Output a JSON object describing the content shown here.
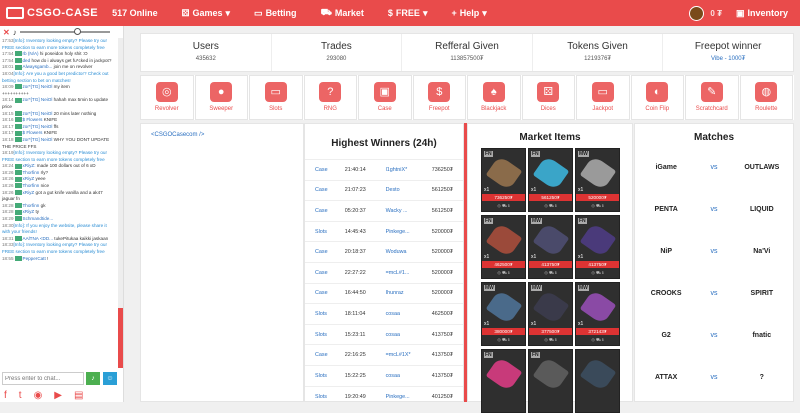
{
  "nav": {
    "logo": "CSGO-CASE",
    "online": "517 Online",
    "games": "Games",
    "betting": "Betting",
    "market": "Market",
    "free": "FREE",
    "help": "Help",
    "coins": "0 ₮",
    "inventory": "Inventory"
  },
  "colors": {
    "accent": "#e94b4b",
    "link": "#2a6fc0"
  },
  "chat": {
    "placeholder": "Press enter to chat...",
    "messages": [
      {
        "t": "17:53",
        "u": "[Info]:",
        "m": "Inventory looking empty? Please try our FREE section to earn more tokens completely free",
        "type": "info"
      },
      {
        "t": "17:54",
        "u": "rb (N/A)",
        "m": "hi poseidon holy shit :O",
        "type": "user"
      },
      {
        "t": "17:54",
        "u": "ded",
        "m": "how do i always get fu*cked in jackpot?",
        "type": "user"
      },
      {
        "t": "18:01",
        "u": "Alwaysgamb...",
        "m": "join me on revolver",
        "type": "user"
      },
      {
        "t": "18:04",
        "u": "[Info]:",
        "m": "Are you a good bet predictor? Check out betting section to bet on matches!",
        "type": "info"
      },
      {
        "t": "18:09",
        "u": "zor*[TG] NeiOl",
        "m": "my item",
        "type": "user"
      },
      {
        "t": "",
        "u": "",
        "m": "++++++++++",
        "type": "plain"
      },
      {
        "t": "18:14",
        "u": "zor*[TG] NeiOl",
        "m": "hahah max 5min to update price",
        "type": "user"
      },
      {
        "t": "18:15",
        "u": "zor*[TG] NeiOl",
        "m": "20 mins later nothing",
        "type": "user"
      },
      {
        "t": "18:16",
        "u": "$ Flowers",
        "m": "KNIFE",
        "type": "user"
      },
      {
        "t": "18:17",
        "u": "zor*[TG] NeiOl",
        "m": "ffs",
        "type": "user"
      },
      {
        "t": "18:17",
        "u": "$ Flowers",
        "m": "KNIFE",
        "type": "user"
      },
      {
        "t": "18:18",
        "u": "zor*[TG] NeiOl",
        "m": "WHY YOU DONT UPDATE THE PRICE FFS",
        "type": "user"
      },
      {
        "t": "18:19",
        "u": "[Info]:",
        "m": "Inventory looking empty? Please try our FREE section to earn more tokens completely free",
        "type": "info"
      },
      {
        "t": "18:24",
        "u": "xRiyZ:",
        "m": "made 100 dollars out of 6 xD",
        "type": "user"
      },
      {
        "t": "18:26",
        "u": "Thorfinn",
        "m": "rly?",
        "type": "user"
      },
      {
        "t": "18:26",
        "u": "xRiyZ",
        "m": "yeee",
        "type": "user"
      },
      {
        "t": "18:26",
        "u": "Thorfinn",
        "m": "nice",
        "type": "user"
      },
      {
        "t": "18:26",
        "u": "xRiyZ",
        "m": "got a gut knife vanilla and a ak47 jaguar fn",
        "type": "user"
      },
      {
        "t": "18:28",
        "u": "Thorfinn",
        "m": "gk",
        "type": "user"
      },
      {
        "t": "18:28",
        "u": "xRiyZ",
        "m": "ty",
        "type": "user"
      },
      {
        "t": "18:29",
        "u": "Schmandtide...",
        "m": "",
        "type": "user"
      },
      {
        "t": "18:30",
        "u": "[Info]:",
        "m": "If you enjoy the website, please share it with your friends!",
        "type": "info"
      },
      {
        "t": "18:31",
        "u": "AAlTNA <DD...",
        "m": "tukePitukaa kaikki jaskaan",
        "type": "user"
      },
      {
        "t": "18:33",
        "u": "[Info]:",
        "m": "Inventory looking empty? Please try our FREE section to earn more tokens completely free",
        "type": "info"
      },
      {
        "t": "18:55",
        "u": "PepperCatt",
        "m": "!",
        "type": "user"
      }
    ]
  },
  "stats": [
    {
      "label": "Users",
      "value": "435632",
      "link": false
    },
    {
      "label": "Trades",
      "value": "293080",
      "link": false
    },
    {
      "label": "Refferal Given",
      "value": "113857500₮",
      "link": false
    },
    {
      "label": "Tokens Given",
      "value": "1219376₮",
      "link": false
    },
    {
      "label": "Freepot winner",
      "value": "Vibe - 1000₮",
      "link": true
    }
  ],
  "games": [
    "Revolver",
    "Sweeper",
    "Slots",
    "RNG",
    "Case",
    "Freepot",
    "Blackjack",
    "Dices",
    "Jackpot",
    "Coin Flip",
    "Scratchcard",
    "Roulette"
  ],
  "panel1": {
    "link": "<CSGOCasecom />"
  },
  "winners": {
    "title": "Highest Winners (24h)",
    "rows": [
      [
        "Case",
        "21:40:14",
        "l1ghtniX*",
        "736250₮"
      ],
      [
        "Case",
        "21:07:23",
        "Desto",
        "561250₮"
      ],
      [
        "Case",
        "05:20:37",
        "Wacky ...",
        "561250₮"
      ],
      [
        "Slots",
        "14:45:43",
        "Pinkege...",
        "520000₮"
      ],
      [
        "Case",
        "20:18:37",
        "Woduwa",
        "520000₮"
      ],
      [
        "Case",
        "22:27:22",
        "=mcL#1...",
        "520000₮"
      ],
      [
        "Case",
        "16:44:50",
        "Ihunraz",
        "520000₮"
      ],
      [
        "Slots",
        "18:11:04",
        "cosaa",
        "462500₮"
      ],
      [
        "Slots",
        "15:23:11",
        "cosaa",
        "413750₮"
      ],
      [
        "Case",
        "22:16:25",
        "=mcL#1X*",
        "413750₮"
      ],
      [
        "Slots",
        "15:22:25",
        "cosaa",
        "413750₮"
      ],
      [
        "Slots",
        "19:20:49",
        "Pinkege...",
        "401250₮"
      ]
    ]
  },
  "market": {
    "title": "Market Items",
    "items": [
      {
        "q": "FN",
        "price": "736250₮",
        "count": "x1",
        "color": "#8a6b4a"
      },
      {
        "q": "FN",
        "price": "561250₮",
        "count": "x1",
        "color": "#3aa5c8"
      },
      {
        "q": "MW",
        "price": "520000₮",
        "count": "x1",
        "color": "#9a9a9a"
      },
      {
        "q": "FN",
        "price": "462500₮",
        "count": "x1",
        "color": "#9b4a3a"
      },
      {
        "q": "MW",
        "price": "413750₮",
        "count": "x1",
        "color": "#4a4a6a"
      },
      {
        "q": "FN",
        "price": "413750₮",
        "count": "x1",
        "color": "#4a3a7a"
      },
      {
        "q": "MW",
        "price": "380000₮",
        "count": "x1",
        "color": "#4a6a8a"
      },
      {
        "q": "MW",
        "price": "377500₮",
        "count": "x1",
        "color": "#3a3a4a"
      },
      {
        "q": "MW",
        "price": "372143₮",
        "count": "x1",
        "color": "#8a4aa5"
      },
      {
        "q": "FN",
        "price": "",
        "count": "",
        "color": "#c83a7a"
      },
      {
        "q": "FN",
        "price": "",
        "count": "",
        "color": "#5a5a5a"
      },
      {
        "q": "",
        "price": "",
        "count": "",
        "color": "#3a4a5a"
      }
    ]
  },
  "matches": {
    "title": "Matches",
    "vs": "vs",
    "rows": [
      {
        "a": "iGame",
        "b": "OUTLAWS"
      },
      {
        "a": "PENTA",
        "b": "LIQUID"
      },
      {
        "a": "NiP",
        "b": "Na'Vi"
      },
      {
        "a": "CROOKS",
        "b": "SPIRIT"
      },
      {
        "a": "G2",
        "b": "fnatic"
      },
      {
        "a": "ATTAX",
        "b": "?"
      }
    ]
  }
}
